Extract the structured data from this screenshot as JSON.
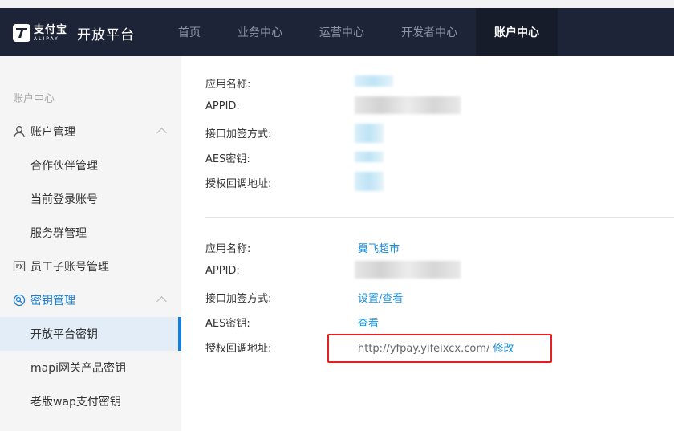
{
  "header": {
    "logo_cn": "支付宝",
    "logo_en": "ALIPAY",
    "platform": "开放平台",
    "nav": [
      "首页",
      "业务中心",
      "运营中心",
      "开发者中心",
      "账户中心"
    ],
    "active_nav": "账户中心"
  },
  "sidebar": {
    "section_title": "账户中心",
    "groups": [
      {
        "label": "账户管理",
        "icon": "user-icon",
        "items": [
          "合作伙伴管理",
          "当前登录账号",
          "服务群管理"
        ]
      },
      {
        "label": "员工子账号管理",
        "icon": "staff-icon"
      },
      {
        "label": "密钥管理",
        "icon": "key-search-icon",
        "items": [
          "开放平台密钥",
          "mapi网关产品密钥",
          "老版wap支付密钥"
        ]
      }
    ],
    "active_item": "开放平台密钥"
  },
  "app1": {
    "labels": [
      "应用名称:",
      "APPID:",
      "接口加签方式:",
      "AES密钥:",
      "授权回调地址:"
    ]
  },
  "app2": {
    "labels": [
      "应用名称:",
      "APPID:",
      "接口加签方式:",
      "AES密钥:",
      "授权回调地址:"
    ],
    "name": "翼飞超市",
    "sign_link": "设置/查看",
    "aes_link": "查看",
    "callback_url": "http://yfpay.yifeixcx.com/",
    "modify_link": "修改"
  },
  "colors": {
    "header_bg": "#1e2437",
    "accent": "#1a7fd4",
    "highlight_border": "#e62020"
  }
}
